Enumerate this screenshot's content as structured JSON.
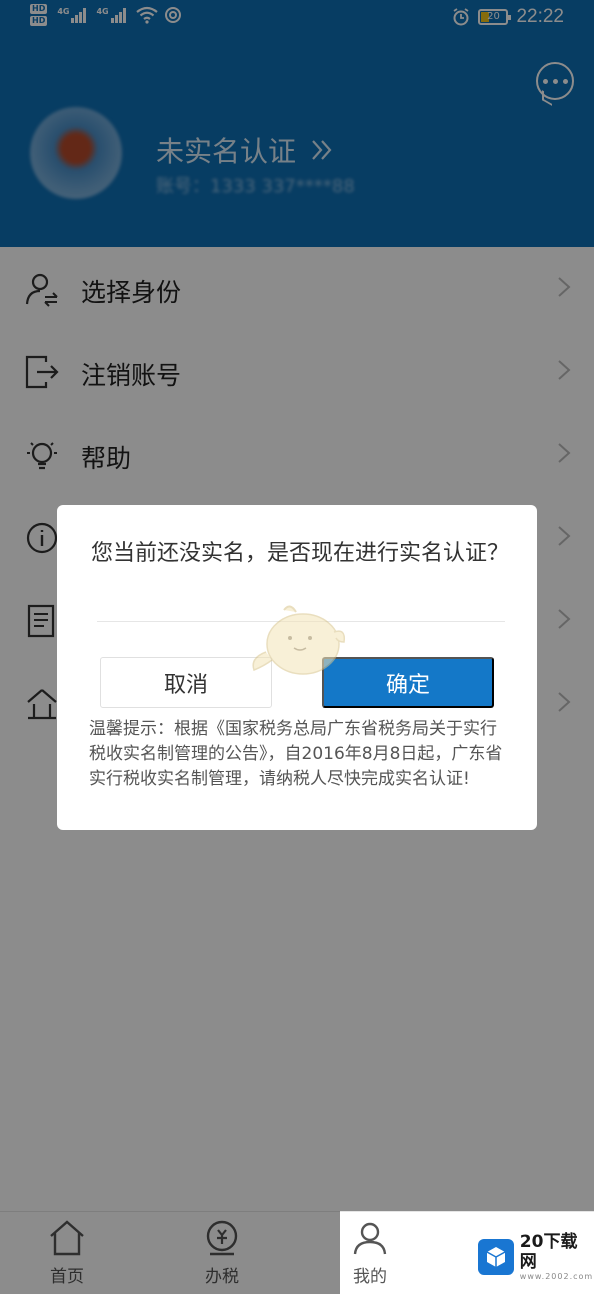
{
  "status_bar": {
    "hd_top": "HD",
    "hd_bottom": "HD",
    "net1": "4G",
    "net2": "4G",
    "battery": "20",
    "time": "22:22"
  },
  "profile": {
    "name": "未实名认证",
    "account": "账号：1333 337****88"
  },
  "menu": {
    "items": [
      {
        "label": "选择身份",
        "icon": "user-switch-icon"
      },
      {
        "label": "注销账号",
        "icon": "logout-icon"
      },
      {
        "label": "帮助",
        "icon": "lightbulb-icon"
      },
      {
        "label": "",
        "icon": "info-icon"
      },
      {
        "label": "",
        "icon": "document-icon"
      },
      {
        "label": "",
        "icon": "settings-icon"
      }
    ]
  },
  "dialog": {
    "message": "您当前还没实名，是否现在进行实名认证？",
    "cancel": "取消",
    "confirm": "确定",
    "tip": "温馨提示：根据《国家税务总局广东省税务局关于实行税收实名制管理的公告》，自2016年8月8日起，广东省实行税收实名制管理，请纳税人尽快完成实名认证!"
  },
  "tabbar": {
    "tabs": [
      {
        "label": "首页",
        "icon": "home-icon"
      },
      {
        "label": "办税",
        "icon": "tax-icon"
      },
      {
        "label": "我的",
        "icon": "user-icon"
      }
    ]
  },
  "watermark": {
    "title": "20下载网",
    "url": "www.2002.com"
  },
  "colors": {
    "header": "#0e6fb4",
    "primary_button": "#1478c8"
  }
}
